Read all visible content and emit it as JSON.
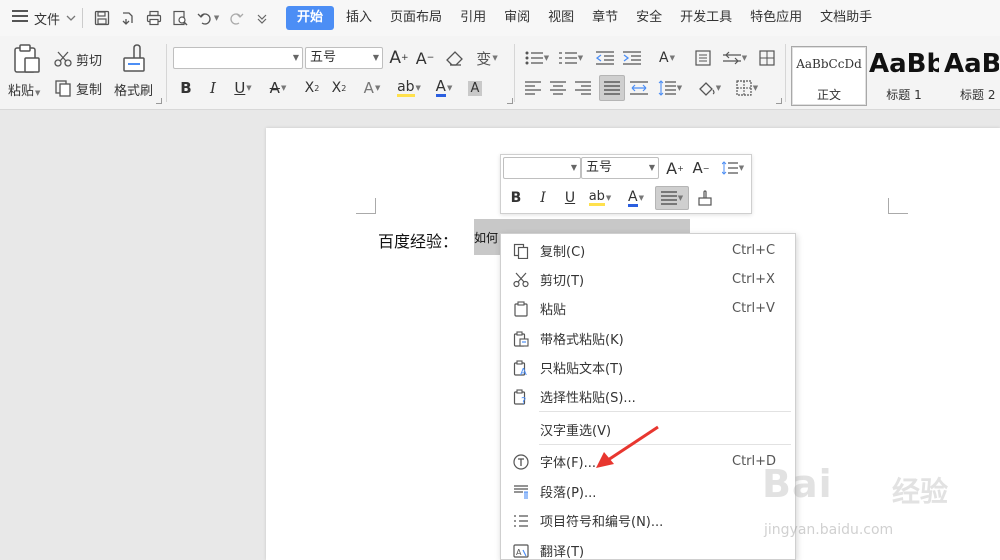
{
  "menubar": {
    "hamburger_label": "文件",
    "tabs": [
      "开始",
      "插入",
      "页面布局",
      "引用",
      "审阅",
      "视图",
      "章节",
      "安全",
      "开发工具",
      "特色应用",
      "文档助手"
    ],
    "active_tab": "开始",
    "accent": "#4c8ef5"
  },
  "ribbon": {
    "paste_label": "粘贴",
    "cut_label": "剪切",
    "copy_label": "复制",
    "format_painter_label": "格式刷",
    "font_name_value": "",
    "font_size_value": "五号",
    "styles": [
      {
        "preview": "AaBbCcDd",
        "label": "正文"
      },
      {
        "preview": "AaBb",
        "label": "标题 1"
      },
      {
        "preview": "AaBb",
        "label": "标题 2"
      }
    ]
  },
  "document": {
    "line_prefix": "百度经验：",
    "selected_text": "如何"
  },
  "mini_toolbar": {
    "font_name_value": "",
    "font_size_value": "五号"
  },
  "context_menu": {
    "items": [
      {
        "label": "复制(C)",
        "shortcut": "Ctrl+C",
        "icon": "copy-icon"
      },
      {
        "label": "剪切(T)",
        "shortcut": "Ctrl+X",
        "icon": "cut-icon"
      },
      {
        "label": "粘贴",
        "shortcut": "Ctrl+V",
        "icon": "paste-icon"
      },
      {
        "label": "带格式粘贴(K)",
        "shortcut": "",
        "icon": "paste-format-icon"
      },
      {
        "label": "只粘贴文本(T)",
        "shortcut": "",
        "icon": "paste-text-icon"
      },
      {
        "label": "选择性粘贴(S)...",
        "shortcut": "",
        "icon": "paste-special-icon"
      },
      {
        "label": "汉字重选(V)",
        "shortcut": "",
        "icon": ""
      },
      {
        "label": "字体(F)...",
        "shortcut": "Ctrl+D",
        "icon": "font-icon"
      },
      {
        "label": "段落(P)...",
        "shortcut": "",
        "icon": "paragraph-icon"
      },
      {
        "label": "项目符号和编号(N)...",
        "shortcut": "",
        "icon": "bullets-icon"
      },
      {
        "label": "翻译(T)",
        "shortcut": "",
        "icon": "translate-icon"
      }
    ]
  },
  "watermark": {
    "logo": "Bai",
    "logo_tail": "经验",
    "url": "jingyan.baidu.com"
  }
}
